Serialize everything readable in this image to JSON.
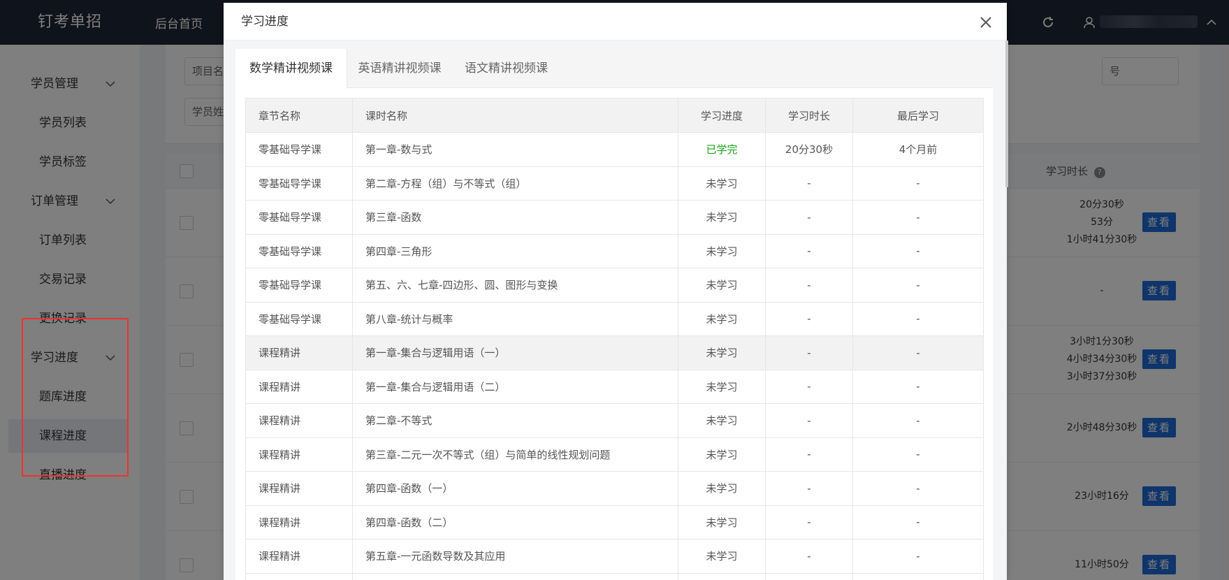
{
  "app": {
    "logo": "钉考单招",
    "nav_home": "后台首页"
  },
  "sidebar": {
    "groups": [
      {
        "label": "学员管理",
        "items": [
          "学员列表",
          "学员标签"
        ]
      },
      {
        "label": "订单管理",
        "items": [
          "订单列表",
          "交易记录",
          "更换记录"
        ]
      },
      {
        "label": "学习进度",
        "items": [
          "题库进度",
          "课程进度",
          "直播进度"
        ]
      }
    ],
    "active_item": "课程进度"
  },
  "background": {
    "filter_fields": [
      "项目名",
      "学员姓",
      "号"
    ],
    "table_header_duration": "学习时长",
    "rows": [
      {
        "durations": [
          "20分30秒",
          "53分",
          "1小时41分30秒"
        ],
        "action": "查看"
      },
      {
        "durations": [
          "-"
        ],
        "action": "查看"
      },
      {
        "durations": [
          "3小时1分30秒",
          "4小时34分30秒",
          "3小时37分30秒"
        ],
        "action": "查看"
      },
      {
        "durations": [
          "2小时48分30秒"
        ],
        "action": "查看"
      },
      {
        "durations": [
          "23小时16分"
        ],
        "action": "查看"
      },
      {
        "durations": [
          "11小时50分"
        ],
        "action": "查看"
      }
    ]
  },
  "modal": {
    "title": "学习进度",
    "tabs": [
      "数学精讲视频课",
      "英语精讲视频课",
      "语文精讲视频课"
    ],
    "active_tab": 0,
    "columns": [
      "章节名称",
      "课时名称",
      "学习进度",
      "学习时长",
      "最后学习"
    ],
    "rows": [
      [
        "零基础导学课",
        "第一章-数与式",
        "已学完",
        "20分30秒",
        "4个月前"
      ],
      [
        "零基础导学课",
        "第二章-方程（组）与不等式（组）",
        "未学习",
        "-",
        "-"
      ],
      [
        "零基础导学课",
        "第三章-函数",
        "未学习",
        "-",
        "-"
      ],
      [
        "零基础导学课",
        "第四章-三角形",
        "未学习",
        "-",
        "-"
      ],
      [
        "零基础导学课",
        "第五、六、七章-四边形、圆、图形与变换",
        "未学习",
        "-",
        "-"
      ],
      [
        "零基础导学课",
        "第八章-统计与概率",
        "未学习",
        "-",
        "-"
      ],
      [
        "课程精讲",
        "第一章-集合与逻辑用语（一）",
        "未学习",
        "-",
        "-"
      ],
      [
        "课程精讲",
        "第一章-集合与逻辑用语（二）",
        "未学习",
        "-",
        "-"
      ],
      [
        "课程精讲",
        "第二章-不等式",
        "未学习",
        "-",
        "-"
      ],
      [
        "课程精讲",
        "第三章-二元一次不等式（组）与简单的线性规划问题",
        "未学习",
        "-",
        "-"
      ],
      [
        "课程精讲",
        "第四章-函数（一）",
        "未学习",
        "-",
        "-"
      ],
      [
        "课程精讲",
        "第四章-函数（二）",
        "未学习",
        "-",
        "-"
      ],
      [
        "课程精讲",
        "第五章-一元函数导数及其应用",
        "未学习",
        "-",
        "-"
      ],
      [
        "",
        "",
        "",
        "",
        ""
      ]
    ],
    "highlighted_row": 6,
    "done_color": "#18a317"
  }
}
